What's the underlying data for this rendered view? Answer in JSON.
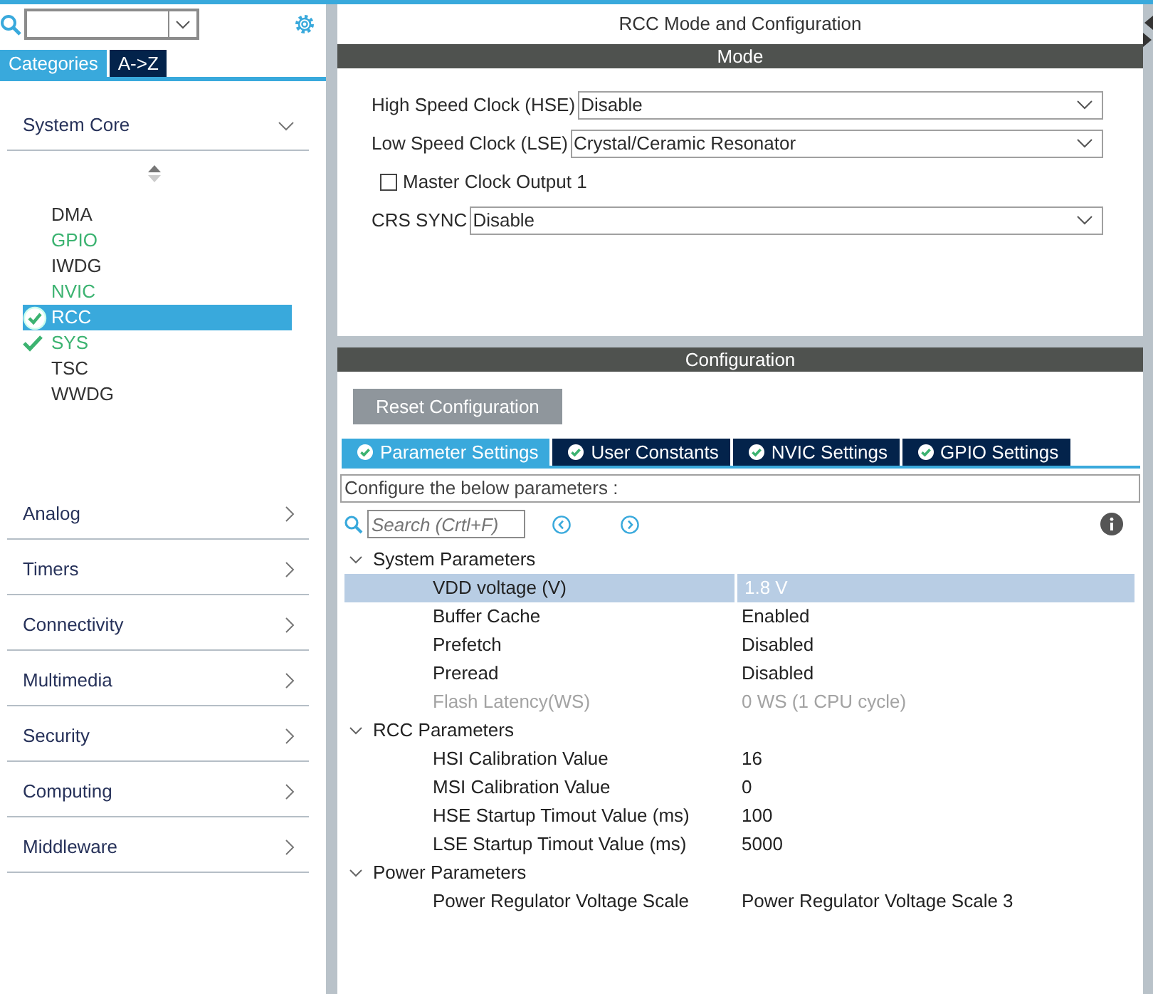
{
  "sidebar": {
    "view_tabs": [
      {
        "label": "Categories",
        "selected": true
      },
      {
        "label": "A->Z",
        "selected": false
      }
    ],
    "categories": [
      {
        "label": "System Core",
        "expanded": true,
        "items": [
          {
            "label": "DMA",
            "configured": false,
            "checked": false,
            "selected": false
          },
          {
            "label": "GPIO",
            "configured": true,
            "checked": false,
            "selected": false
          },
          {
            "label": "IWDG",
            "configured": false,
            "checked": false,
            "selected": false
          },
          {
            "label": "NVIC",
            "configured": true,
            "checked": false,
            "selected": false
          },
          {
            "label": "RCC",
            "configured": false,
            "checked": true,
            "selected": true
          },
          {
            "label": "SYS",
            "configured": true,
            "checked": true,
            "selected": false
          },
          {
            "label": "TSC",
            "configured": false,
            "checked": false,
            "selected": false
          },
          {
            "label": "WWDG",
            "configured": false,
            "checked": false,
            "selected": false
          }
        ]
      },
      {
        "label": "Analog",
        "expanded": false
      },
      {
        "label": "Timers",
        "expanded": false
      },
      {
        "label": "Connectivity",
        "expanded": false
      },
      {
        "label": "Multimedia",
        "expanded": false
      },
      {
        "label": "Security",
        "expanded": false
      },
      {
        "label": "Computing",
        "expanded": false
      },
      {
        "label": "Middleware",
        "expanded": false
      }
    ]
  },
  "main": {
    "title": "RCC Mode and Configuration",
    "mode": {
      "header": "Mode",
      "fields": [
        {
          "kind": "select",
          "label": "High Speed Clock (HSE)",
          "value": "Disable"
        },
        {
          "kind": "select",
          "label": "Low Speed Clock (LSE)",
          "value": "Crystal/Ceramic Resonator"
        },
        {
          "kind": "checkbox",
          "label": "Master Clock Output 1",
          "checked": false
        },
        {
          "kind": "select",
          "label": "CRS SYNC",
          "value": "Disable"
        }
      ]
    },
    "configuration": {
      "header": "Configuration",
      "reset_button": "Reset Configuration",
      "tabs": [
        {
          "label": "Parameter Settings",
          "selected": true
        },
        {
          "label": "User Constants",
          "selected": false
        },
        {
          "label": "NVIC Settings",
          "selected": false
        },
        {
          "label": "GPIO Settings",
          "selected": false
        }
      ],
      "hint": "Configure the below parameters :",
      "search": {
        "placeholder": "Search (Crtl+F)"
      },
      "groups": [
        {
          "name": "System Parameters",
          "expanded": true,
          "params": [
            {
              "name": "VDD voltage (V)",
              "value": "1.8 V",
              "selected": true,
              "disabled": false
            },
            {
              "name": "Buffer Cache",
              "value": "Enabled",
              "selected": false,
              "disabled": false
            },
            {
              "name": "Prefetch",
              "value": "Disabled",
              "selected": false,
              "disabled": false
            },
            {
              "name": "Preread",
              "value": "Disabled",
              "selected": false,
              "disabled": false
            },
            {
              "name": "Flash Latency(WS)",
              "value": "0 WS (1 CPU cycle)",
              "selected": false,
              "disabled": true
            }
          ]
        },
        {
          "name": "RCC Parameters",
          "expanded": true,
          "params": [
            {
              "name": "HSI Calibration Value",
              "value": "16",
              "selected": false,
              "disabled": false
            },
            {
              "name": "MSI Calibration Value",
              "value": "0",
              "selected": false,
              "disabled": false
            },
            {
              "name": "HSE Startup Timout Value (ms)",
              "value": "100",
              "selected": false,
              "disabled": false
            },
            {
              "name": "LSE Startup Timout Value (ms)",
              "value": "5000",
              "selected": false,
              "disabled": false
            }
          ]
        },
        {
          "name": "Power Parameters",
          "expanded": true,
          "params": [
            {
              "name": "Power Regulator Voltage Scale",
              "value": "Power Regulator Voltage Scale 3",
              "selected": false,
              "disabled": false
            }
          ]
        }
      ]
    }
  }
}
